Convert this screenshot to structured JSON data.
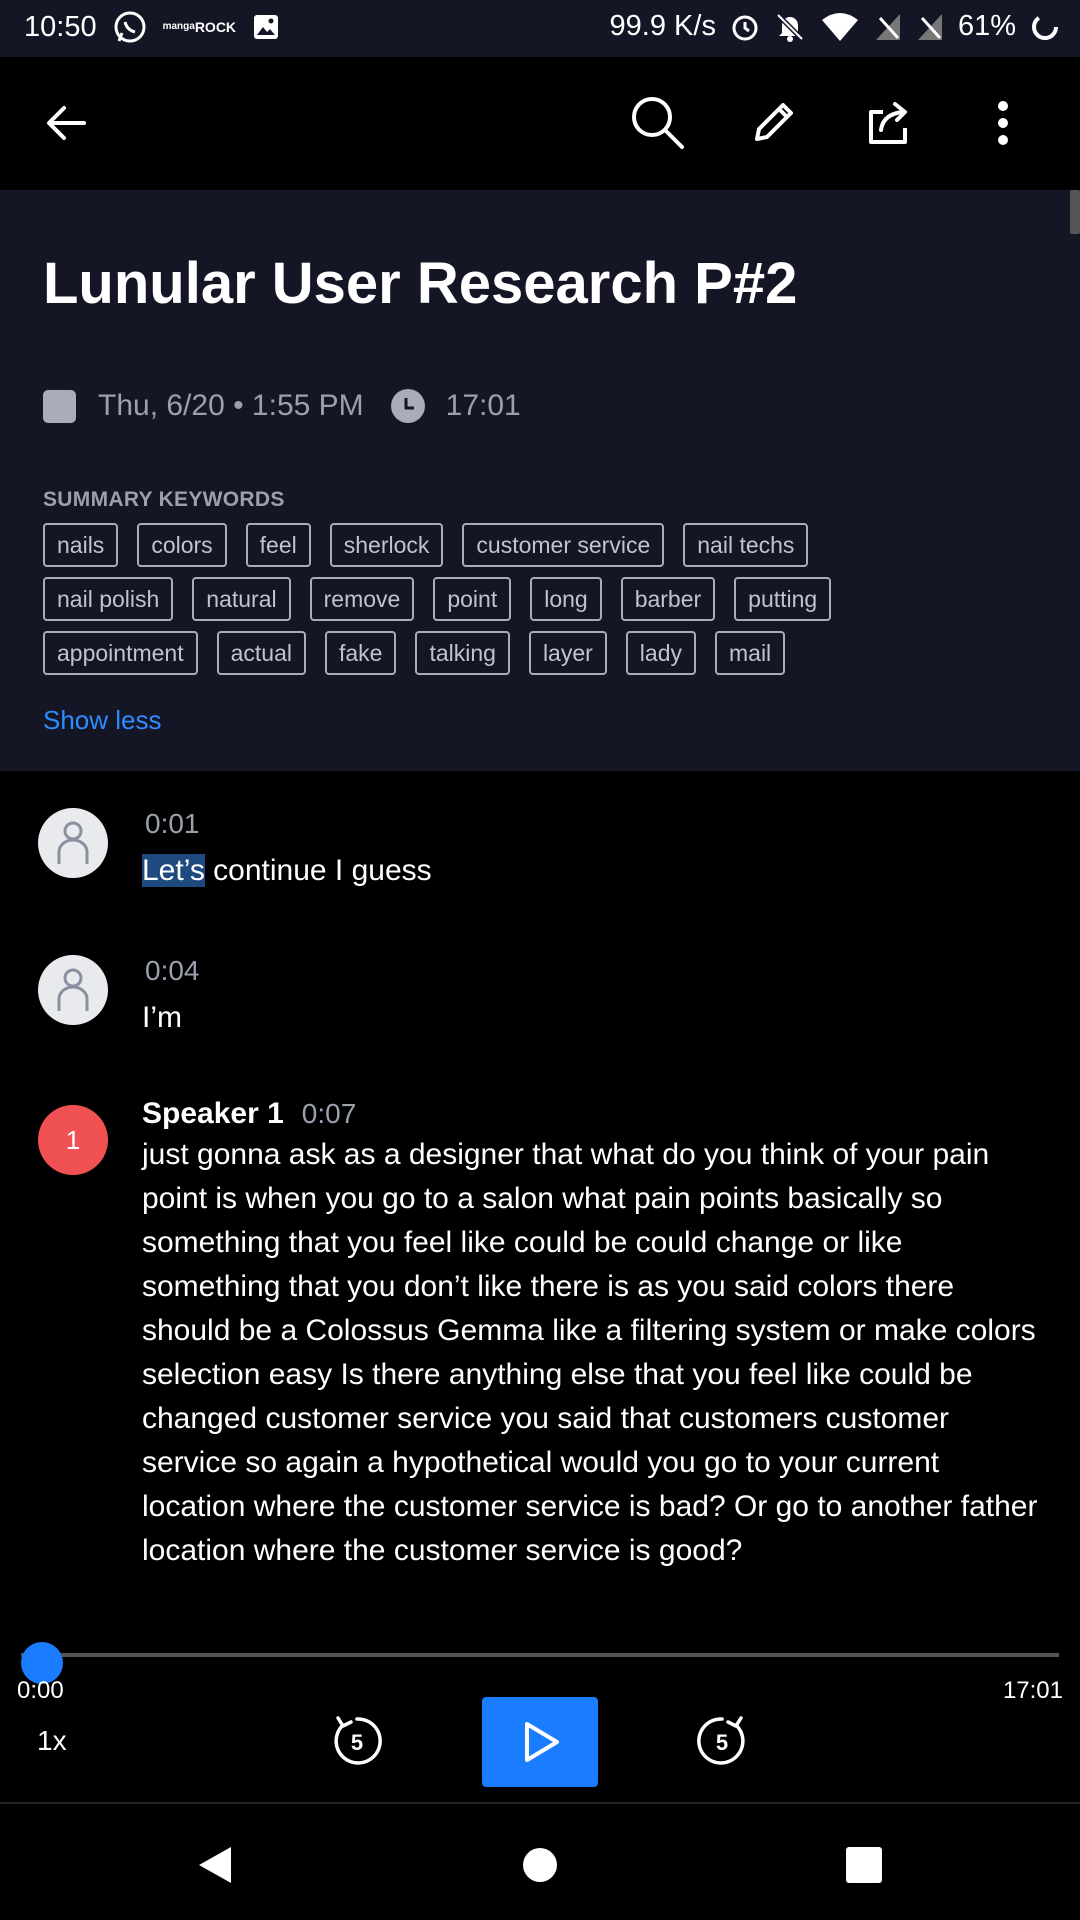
{
  "status_bar": {
    "time": "10:50",
    "app_icon_top": "manga",
    "app_icon_bottom": "ROCK",
    "net_speed": "99.9 K/s",
    "battery": "61%",
    "icons": [
      "whatsapp-icon",
      "manga-rock-icon",
      "image-icon",
      "alarm-icon",
      "bell-off-icon",
      "wifi-icon",
      "no-sim-icon",
      "no-sim-icon",
      "battery-icon"
    ]
  },
  "appbar": {
    "icons": [
      "back-arrow-icon",
      "search-icon",
      "edit-pencil-icon",
      "share-icon",
      "more-vert-icon"
    ]
  },
  "note": {
    "title": "Lunular User Research P#2",
    "date": "Thu, 6/20 • 1:55 PM",
    "duration": "17:01",
    "keywords_label": "SUMMARY KEYWORDS",
    "keyword_rows": [
      [
        "nails",
        "colors",
        "feel",
        "sherlock",
        "customer service",
        "nail techs"
      ],
      [
        "nail polish",
        "natural",
        "remove",
        "point",
        "long",
        "barber",
        "putting"
      ],
      [
        "appointment",
        "actual",
        "fake",
        "talking",
        "layer",
        "lady",
        "mail"
      ]
    ],
    "show_less": "Show less"
  },
  "transcript": [
    {
      "time": "0:01",
      "highlight": "Let’s",
      "rest": " continue I guess"
    },
    {
      "time": "0:04",
      "text": "I’m"
    },
    {
      "speaker_badge": "1",
      "speaker": "Speaker 1",
      "time": "0:07",
      "text": "just gonna ask as a designer that what do you think of your pain point is when you go to a salon what pain points basically so something that you feel like could be could change or like something that you don’t like there is as you said colors there should be a Colossus Gemma like a filtering system or make colors selection easy Is there anything else that you feel like could be changed customer service you said that customers customer service so again a hypothetical would you go to your current location where the customer service is bad? Or go to another father location where the customer service is good?"
    }
  ],
  "player": {
    "current": "0:00",
    "total": "17:01",
    "progress": 0,
    "speed": "1x",
    "skip_seconds": "5"
  },
  "colors": {
    "accent": "#1a7cff",
    "header_bg": "#141626",
    "speaker_badge": "#f05253",
    "link": "#2d8cff"
  }
}
